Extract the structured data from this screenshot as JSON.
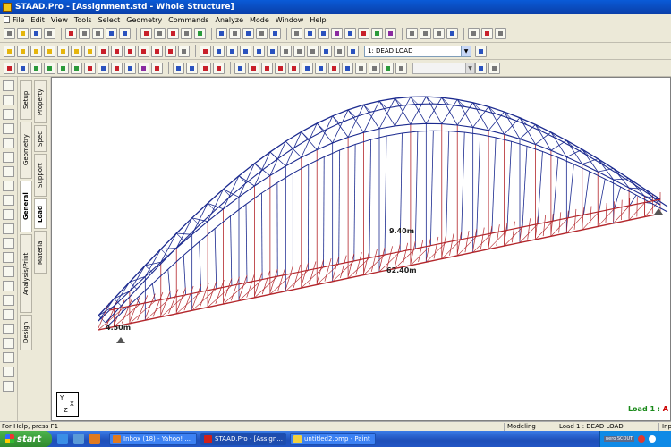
{
  "window": {
    "title": "STAAD.Pro - [Assignment.std - Whole Structure]"
  },
  "menu": [
    "File",
    "Edit",
    "View",
    "Tools",
    "Select",
    "Geometry",
    "Commands",
    "Analyze",
    "Mode",
    "Window",
    "Help"
  ],
  "toolbar": {
    "load_case_selected": "1: DEAD LOAD"
  },
  "page_tabs": {
    "main": [
      "Setup",
      "Geometry",
      "General",
      "Analysis/Print",
      "Design"
    ],
    "sub": [
      "Property",
      "Spec",
      "Support",
      "Load",
      "Material"
    ],
    "active_main": "General",
    "active_sub": "Load"
  },
  "viewport": {
    "dim_height": "9.40m",
    "dim_span": "62.40m",
    "dim_end": "4.50m",
    "axis_y": "Y",
    "axis_x": "X",
    "axis_z": "Z",
    "load_indicator": "Load 1 : ",
    "load_indicator_end": "A",
    "colors": {
      "chord": "#1b2a8f",
      "deck": "#b3262b",
      "hanger_red": "#b3262b",
      "hanger_blue": "#1b2a8f"
    }
  },
  "status": {
    "help": "For Help, press F1",
    "mode": "Modeling Mode",
    "load": "Load 1 : DEAD LOAD",
    "input": "Inpu"
  },
  "taskbar": {
    "start": "start",
    "tasks": [
      {
        "label": "Inbox (18) - Yahoo! ...",
        "icon_color": "#e07a20"
      },
      {
        "label": "STAAD.Pro - [Assign...",
        "icon_color": "#d0201a"
      },
      {
        "label": "untitled2.bmp - Paint",
        "icon_color": "#f0d040"
      }
    ],
    "tray_logo": "nero SCOUT"
  }
}
